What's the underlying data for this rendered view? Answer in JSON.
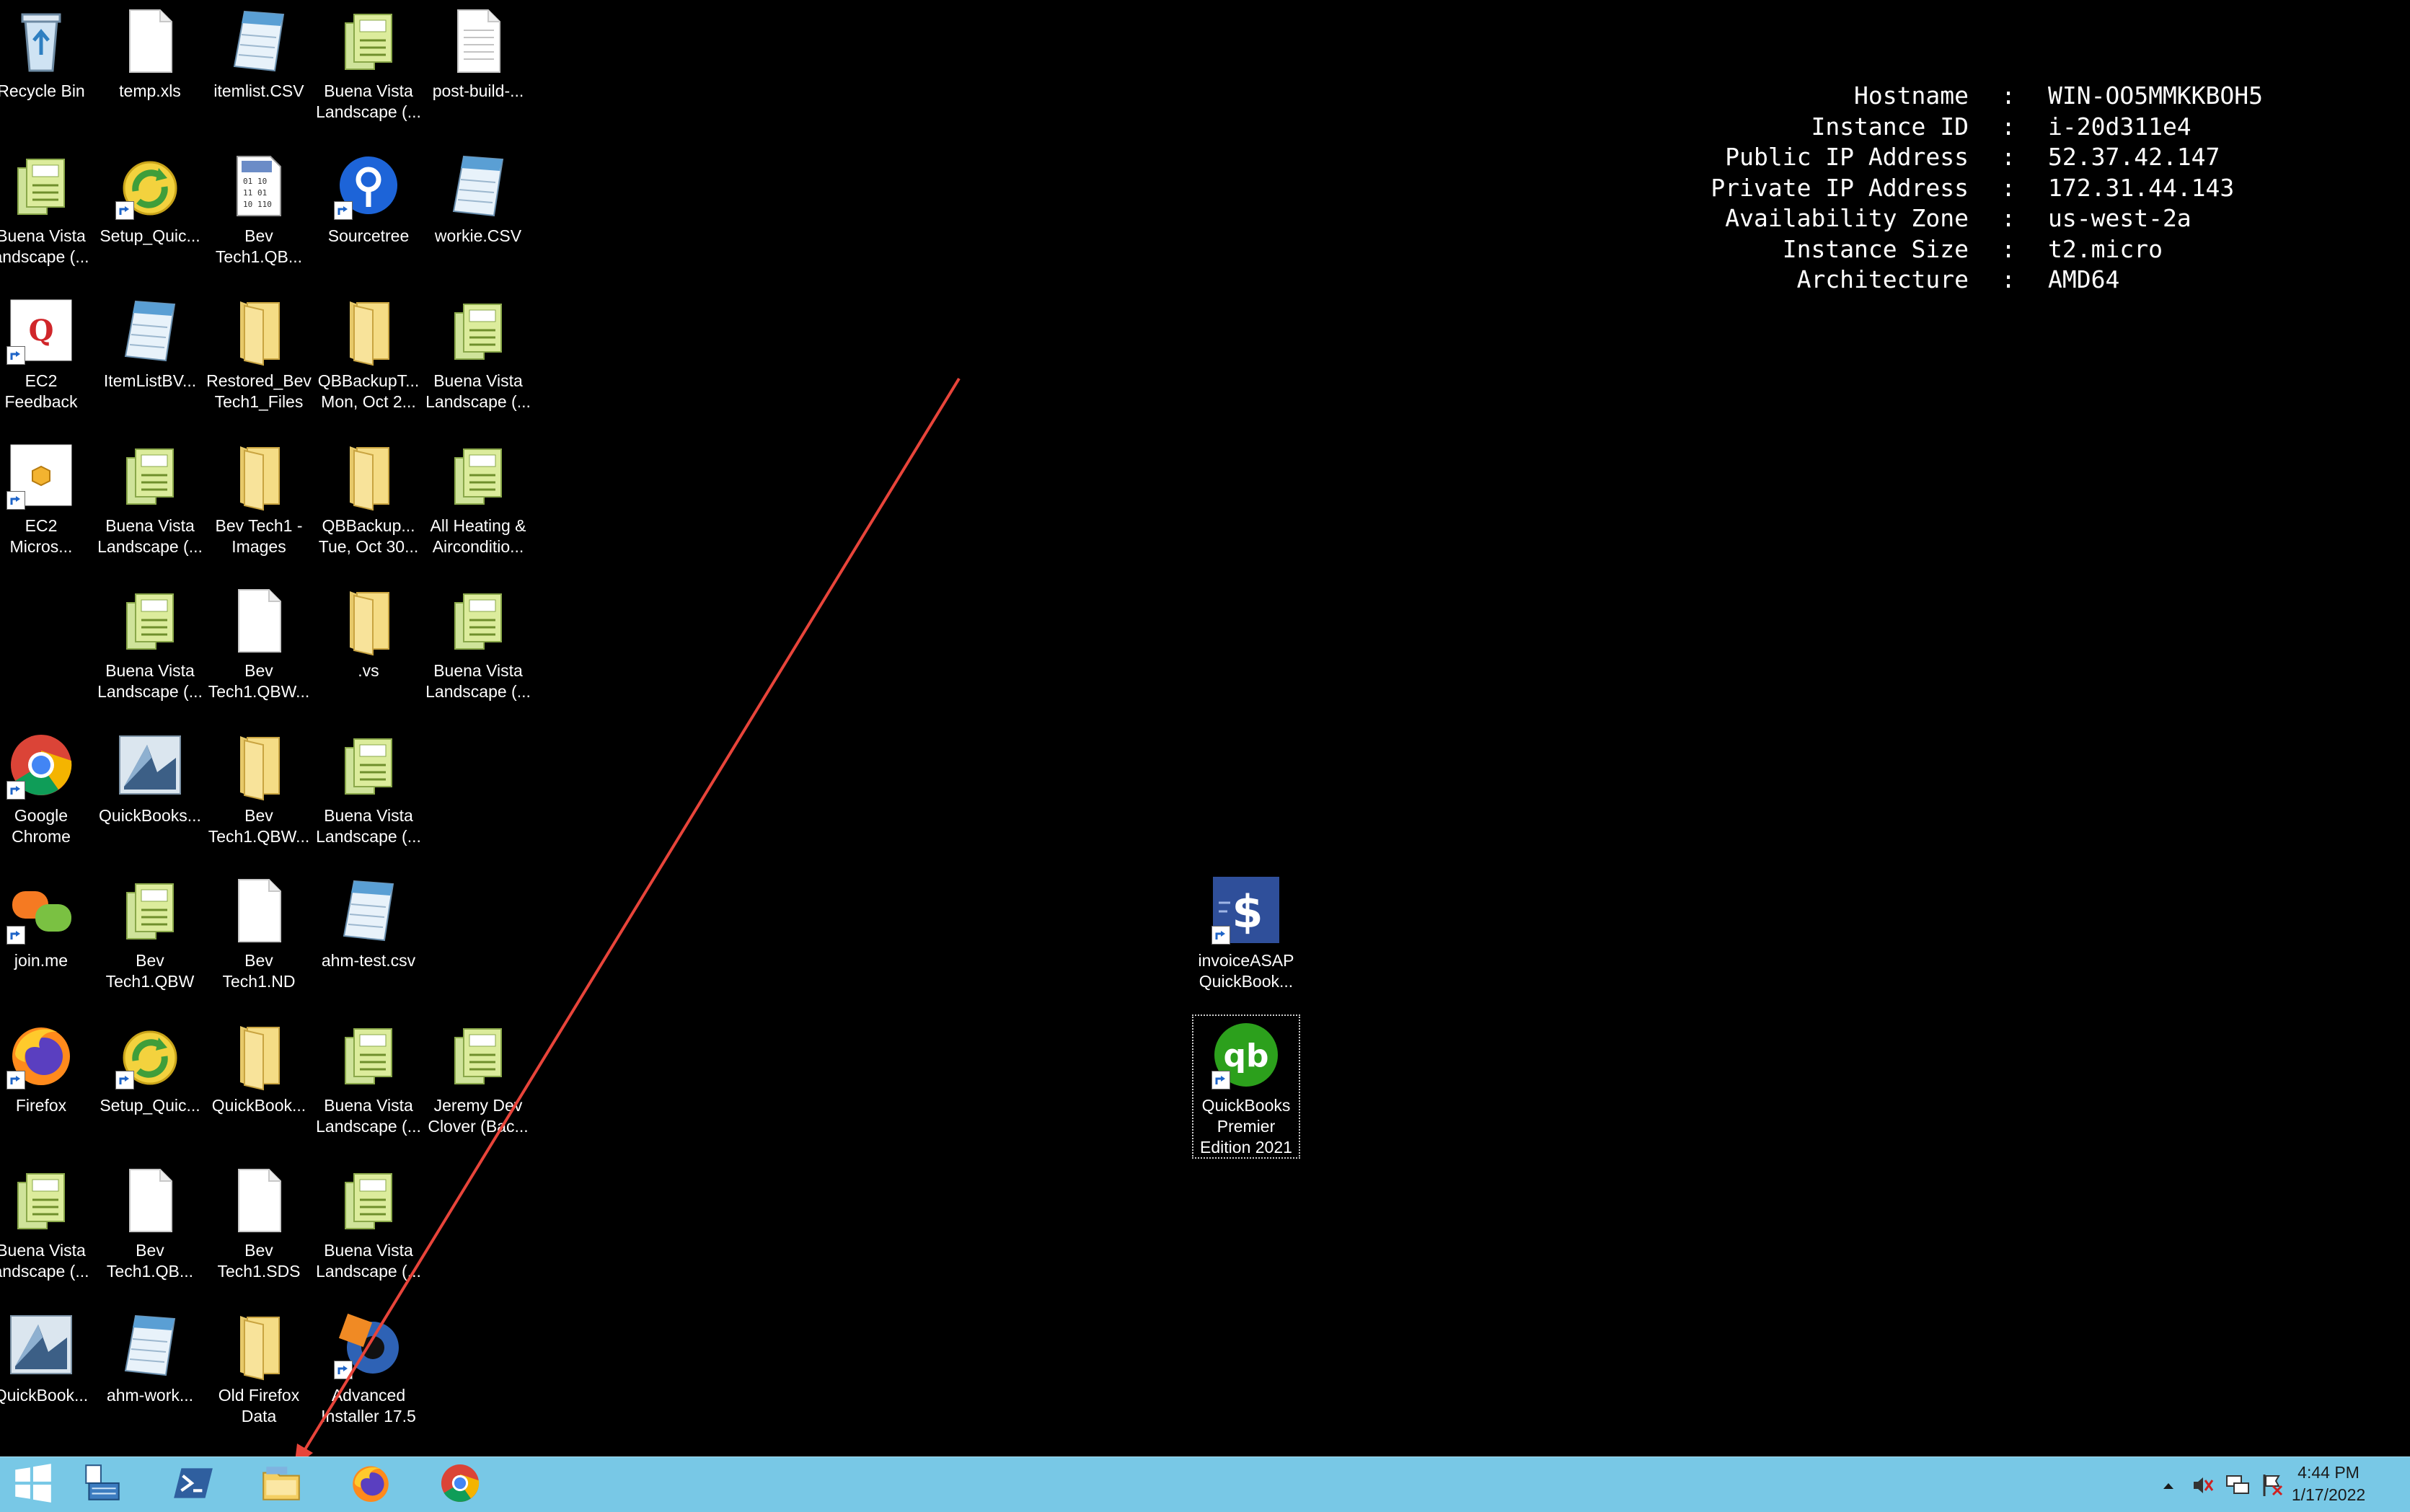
{
  "desktop": {
    "icons": [
      {
        "label": "Recycle Bin",
        "icon": "recycle-bin-icon",
        "kind": "recycle",
        "shortcut": false
      },
      {
        "label": "temp.xls",
        "icon": "blank-file-icon",
        "kind": "file",
        "shortcut": false
      },
      {
        "label": "itemlist.CSV",
        "icon": "notepad-file-icon",
        "kind": "csv",
        "shortcut": false
      },
      {
        "label": "Buena Vista\nLandscape (...",
        "icon": "quickbooks-file-icon",
        "kind": "qbw",
        "shortcut": false
      },
      {
        "label": "post-build-...",
        "icon": "text-file-icon",
        "kind": "text",
        "shortcut": false
      },
      {
        "label": "Buena Vista\nandscape (...",
        "icon": "quickbooks-file-icon",
        "kind": "qbw",
        "shortcut": false
      },
      {
        "label": "Setup_Quic...",
        "icon": "setup-installer-icon",
        "kind": "setup",
        "shortcut": true
      },
      {
        "label": "Bev\nTech1.QB...",
        "icon": "data-file-icon",
        "kind": "datafile",
        "shortcut": false
      },
      {
        "label": "Sourcetree",
        "icon": "sourcetree-icon",
        "kind": "sourcetree",
        "shortcut": true
      },
      {
        "label": "workie.CSV",
        "icon": "notepad-file-icon",
        "kind": "csv",
        "shortcut": false
      },
      {
        "label": "EC2\nFeedback",
        "icon": "ec2-feedback-icon",
        "kind": "feedback",
        "shortcut": true
      },
      {
        "label": "ItemListBV...",
        "icon": "notepad-file-icon",
        "kind": "csv",
        "shortcut": false
      },
      {
        "label": "Restored_Bev\nTech1_Files",
        "icon": "folder-icon",
        "kind": "folder",
        "shortcut": false
      },
      {
        "label": "QBBackupT...\nMon, Oct 2...",
        "icon": "folder-icon",
        "kind": "folder",
        "shortcut": false
      },
      {
        "label": "Buena Vista\nLandscape (...",
        "icon": "quickbooks-file-icon",
        "kind": "qbw",
        "shortcut": false
      },
      {
        "label": "EC2\nMicros...",
        "icon": "ec2-box-icon",
        "kind": "ec2box",
        "shortcut": true
      },
      {
        "label": "Buena Vista\nLandscape (...",
        "icon": "quickbooks-file-icon",
        "kind": "qbw",
        "shortcut": false
      },
      {
        "label": "Bev Tech1 -\nImages",
        "icon": "folder-icon",
        "kind": "folder",
        "shortcut": false
      },
      {
        "label": "QBBackup...\nTue, Oct 30...",
        "icon": "folder-icon",
        "kind": "folder",
        "shortcut": false
      },
      {
        "label": "All Heating &\nAirconditio...",
        "icon": "quickbooks-file-icon",
        "kind": "qbw",
        "shortcut": false
      },
      {
        "label": "Buena Vista\nLandscape (...",
        "icon": "quickbooks-file-icon",
        "kind": "qbw",
        "shortcut": false
      },
      {
        "label": "Bev\nTech1.QBW...",
        "icon": "blank-file-icon",
        "kind": "file",
        "shortcut": false
      },
      {
        "label": ".vs",
        "icon": "folder-icon",
        "kind": "folder",
        "shortcut": false
      },
      {
        "label": "Buena Vista\nLandscape (...",
        "icon": "quickbooks-file-icon",
        "kind": "qbw",
        "shortcut": false
      },
      {
        "label": "Google\nChrome",
        "icon": "chrome-icon",
        "kind": "chrome",
        "shortcut": true
      },
      {
        "label": "QuickBooks...",
        "icon": "quickbooks-app-icon",
        "kind": "qbapp",
        "shortcut": false
      },
      {
        "label": "Bev\nTech1.QBW...",
        "icon": "folder-icon",
        "kind": "folder",
        "shortcut": false
      },
      {
        "label": "Buena Vista\nLandscape (...",
        "icon": "quickbooks-file-icon",
        "kind": "qbw",
        "shortcut": false
      },
      {
        "label": "join.me",
        "icon": "joinme-icon",
        "kind": "joinme",
        "shortcut": true
      },
      {
        "label": "Bev\nTech1.QBW",
        "icon": "quickbooks-file-icon",
        "kind": "qbw",
        "shortcut": false
      },
      {
        "label": "Bev\nTech1.ND",
        "icon": "blank-file-icon",
        "kind": "file",
        "shortcut": false
      },
      {
        "label": "ahm-test.csv",
        "icon": "notepad-file-icon",
        "kind": "csv",
        "shortcut": false
      },
      {
        "label": "Firefox",
        "icon": "firefox-icon",
        "kind": "firefox",
        "shortcut": true
      },
      {
        "label": "Setup_Quic...",
        "icon": "setup-installer-icon",
        "kind": "setup",
        "shortcut": true
      },
      {
        "label": "QuickBook...",
        "icon": "folder-icon",
        "kind": "folder",
        "shortcut": false
      },
      {
        "label": "Buena Vista\nLandscape (...",
        "icon": "quickbooks-file-icon",
        "kind": "qbw",
        "shortcut": false
      },
      {
        "label": "Jeremy Dev\nClover (Bac...",
        "icon": "quickbooks-file-icon",
        "kind": "qbw",
        "shortcut": false
      },
      {
        "label": "Buena Vista\nandscape (...",
        "icon": "quickbooks-file-icon",
        "kind": "qbw",
        "shortcut": false
      },
      {
        "label": "Bev\nTech1.QB...",
        "icon": "blank-file-icon",
        "kind": "file",
        "shortcut": false
      },
      {
        "label": "Bev\nTech1.SDS",
        "icon": "blank-file-icon",
        "kind": "file",
        "shortcut": false
      },
      {
        "label": "Buena Vista\nLandscape (...",
        "icon": "quickbooks-file-icon",
        "kind": "qbw",
        "shortcut": false
      },
      {
        "label": "QuickBook...",
        "icon": "quickbooks-app-icon",
        "kind": "qbapp",
        "shortcut": false
      },
      {
        "label": "ahm-work...",
        "icon": "notepad-file-icon",
        "kind": "csv",
        "shortcut": false
      },
      {
        "label": "Old Firefox\nData",
        "icon": "folder-icon",
        "kind": "folder",
        "shortcut": false
      },
      {
        "label": "Advanced\nInstaller 17.5",
        "icon": "advanced-installer-icon",
        "kind": "advinst",
        "shortcut": true
      },
      {
        "label": "invoiceASAP\nQuickBook...",
        "icon": "invoiceasap-icon",
        "kind": "invoice",
        "shortcut": true
      },
      {
        "label": "QuickBooks\nPremier\nEdition 2021",
        "icon": "quickbooks-premier-icon",
        "kind": "qbpremier",
        "shortcut": true,
        "selected": true
      }
    ]
  },
  "instance_info": [
    {
      "key": "Hostname",
      "value": "WIN-OO5MMKKBOH5"
    },
    {
      "key": "Instance ID",
      "value": "i-20d311e4"
    },
    {
      "key": "Public IP Address",
      "value": "52.37.42.147"
    },
    {
      "key": "Private IP Address",
      "value": "172.31.44.143"
    },
    {
      "key": "Availability Zone",
      "value": "us-west-2a"
    },
    {
      "key": "Instance Size",
      "value": "t2.micro"
    },
    {
      "key": "Architecture",
      "value": "AMD64"
    }
  ],
  "info_separator": ":",
  "taskbar": {
    "buttons": [
      {
        "name": "start-button",
        "icon": "windows-logo-icon"
      },
      {
        "name": "server-manager-button",
        "icon": "server-manager-icon"
      },
      {
        "name": "powershell-button",
        "icon": "powershell-icon"
      },
      {
        "name": "file-explorer-button",
        "icon": "file-explorer-icon"
      },
      {
        "name": "firefox-taskbar-button",
        "icon": "firefox-icon"
      },
      {
        "name": "chrome-taskbar-button",
        "icon": "chrome-icon"
      }
    ],
    "tray": [
      {
        "name": "show-hidden-icons-button",
        "icon": "chevron-up-icon"
      },
      {
        "name": "volume-muted-tray",
        "icon": "speaker-muted-icon"
      },
      {
        "name": "network-tray",
        "icon": "network-icon"
      },
      {
        "name": "action-center-flag-tray",
        "icon": "flag-alert-icon"
      }
    ],
    "clock": {
      "time": "4:44 PM",
      "date": "1/17/2022"
    }
  },
  "colors": {
    "desktop_bg": "#000000",
    "taskbar_bg": "#78c8e6",
    "annotation_arrow": "#e8443a"
  }
}
